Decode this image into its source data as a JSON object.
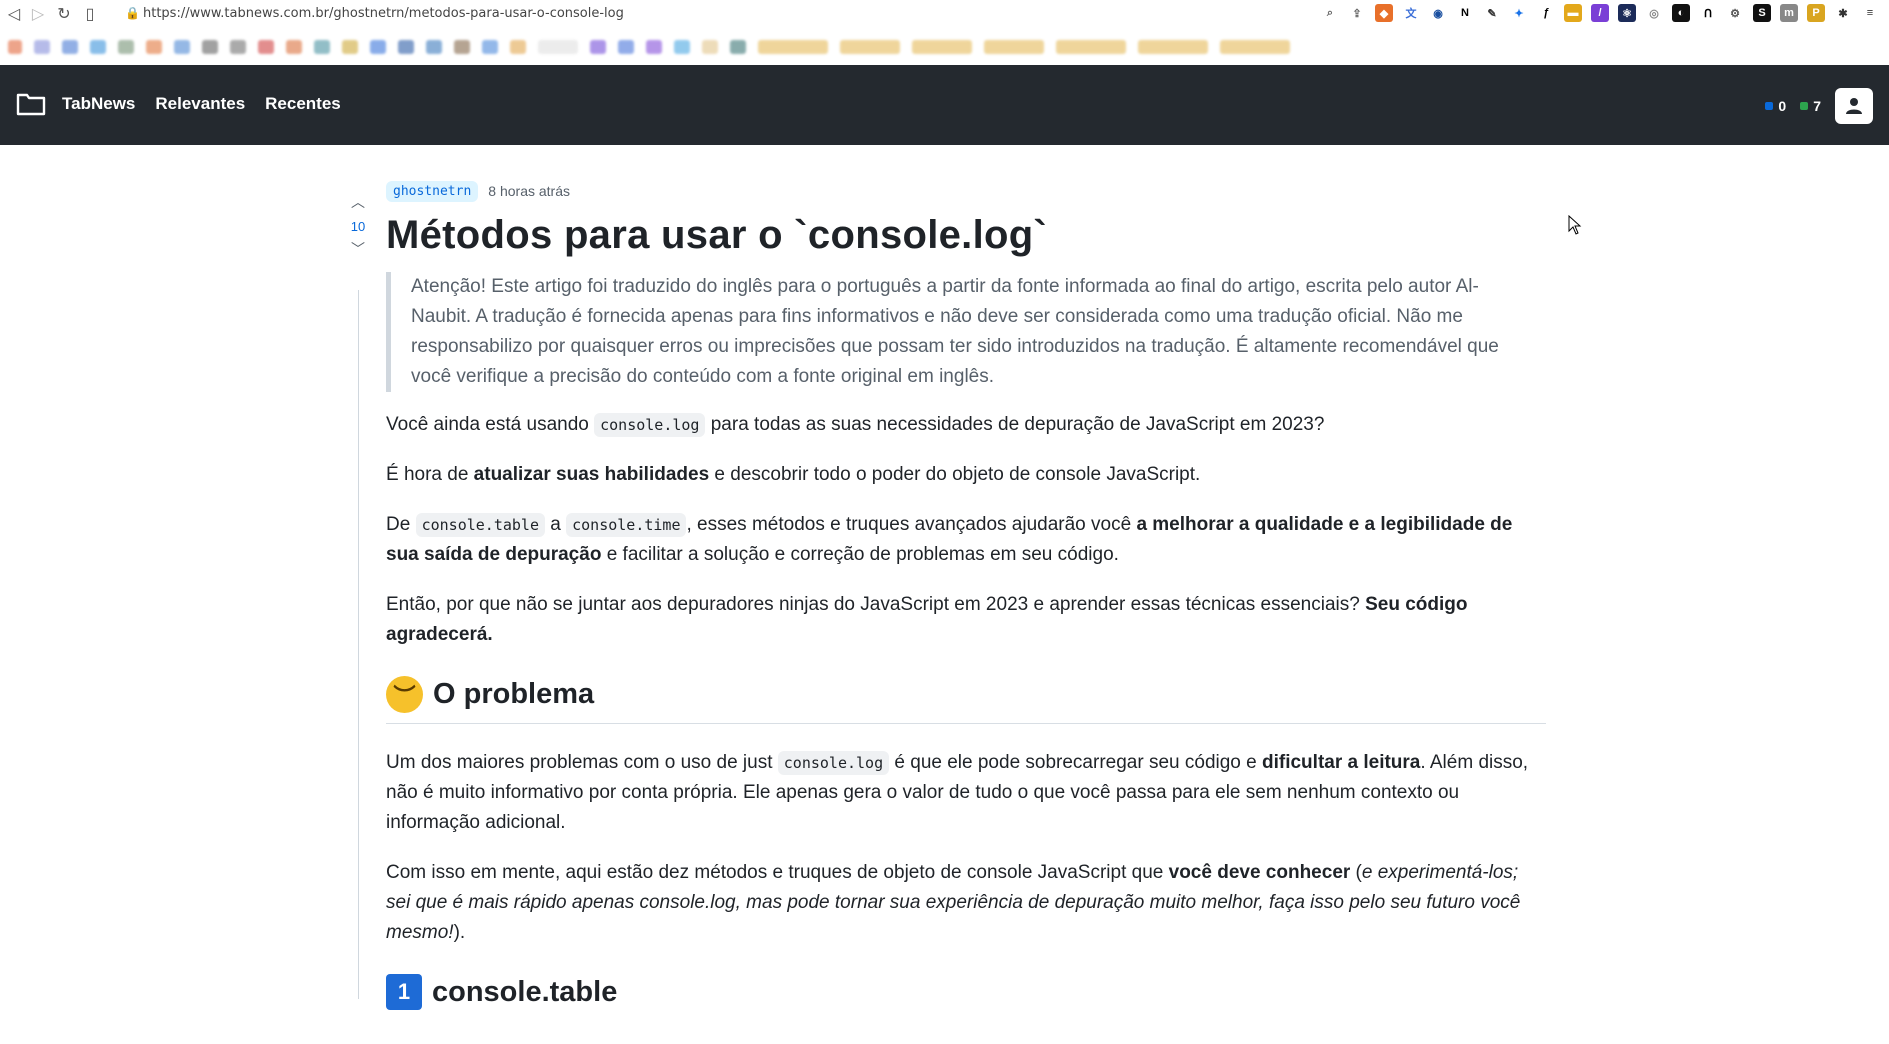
{
  "browser": {
    "url": "https://www.tabnews.com.br/ghostnetrn/metodos-para-usar-o-console-log"
  },
  "header": {
    "site_name": "TabNews",
    "nav": [
      "Relevantes",
      "Recentes"
    ],
    "tabcoins": "0",
    "tabcash": "7"
  },
  "article": {
    "author": "ghostnetrn",
    "time": "8 horas atrás",
    "score": "10",
    "title": "Métodos para usar o `console.log`",
    "notice": "Atenção! Este artigo foi traduzido do inglês para o português a partir da fonte informada ao final do artigo, escrita pelo autor Al-Naubit. A tradução é fornecida apenas para fins informativos e não deve ser considerada como uma tradução oficial. Não me responsabilizo por quaisquer erros ou imprecisões que possam ter sido introduzidos na tradução. É altamente recomendável que você verifique a precisão do conteúdo com a fonte original em inglês.",
    "p1_a": "Você ainda está usando ",
    "p1_code": "console.log",
    "p1_b": " para todas as suas necessidades de depuração de JavaScript em 2023?",
    "p2_a": "É hora de ",
    "p2_bold": "atualizar suas habilidades",
    "p2_b": " e descobrir todo o poder do objeto de console JavaScript.",
    "p3_a": "De ",
    "p3_code1": "console.table",
    "p3_mid": " a ",
    "p3_code2": "console.time",
    "p3_b": ", esses métodos e truques avançados ajudarão você ",
    "p3_bold": "a melhorar a qualidade e a legibilidade de sua saída de depuração",
    "p3_c": " e facilitar a solução e correção de problemas em seu código.",
    "p4_a": "Então, por que não se juntar aos depuradores ninjas do JavaScript em 2023 e aprender essas técnicas essenciais? ",
    "p4_bold": "Seu código agradecerá.",
    "h2_problem": "O problema",
    "p5_a": "Um dos maiores problemas com o uso de just ",
    "p5_code": "console.log",
    "p5_b": " é que ele pode sobrecarregar seu código e ",
    "p5_bold": "dificultar a leitura",
    "p5_c": ". Além disso, não é muito informativo por conta própria. Ele apenas gera o valor de tudo o que você passa para ele sem nenhum contexto ou informação adicional.",
    "p6_a": "Com isso em mente, aqui estão dez métodos e truques de objeto de console JavaScript que ",
    "p6_bold": "você deve conhecer",
    "p6_b": " (",
    "p6_italic": "e experimentá-los; sei que é mais rápido apenas console.log, mas pode tornar sua experiência de depuração muito melhor, faça isso pelo seu futuro você mesmo!",
    "p6_c": ").",
    "h2_next_num": "1",
    "h2_next": "console.table"
  },
  "colors": {
    "header_bg": "#24292f",
    "link_blue": "#0969da"
  }
}
